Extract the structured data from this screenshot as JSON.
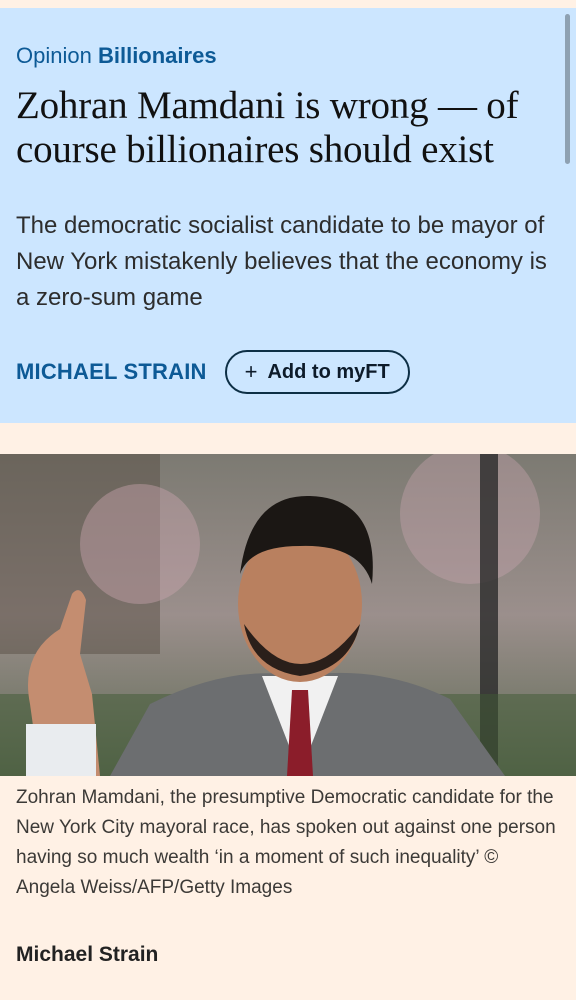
{
  "topic": {
    "label": "Opinion",
    "name": "Billionaires"
  },
  "article": {
    "headline": "Zohran Mamdani is wrong — of course billionaires should exist",
    "standfirst": "The democratic socialist candidate to be mayor of New York mistakenly believes that the economy is a zero-sum game",
    "author_link": "MICHAEL STRAIN",
    "add_myft_label": "Add to myFT",
    "plus_symbol": "+"
  },
  "image": {
    "caption": "Zohran Mamdani, the presumptive Democratic candidate for the New York City mayoral race, has spoken out against one person having so much wealth ‘in a moment of such inequality’ © Angela Weiss/AFP/Getty Images"
  },
  "footer": {
    "author_name": "Michael Strain"
  },
  "colors": {
    "hero_bg": "#cce6ff",
    "page_bg": "#fff1e5",
    "link_blue": "#0d5a96"
  }
}
